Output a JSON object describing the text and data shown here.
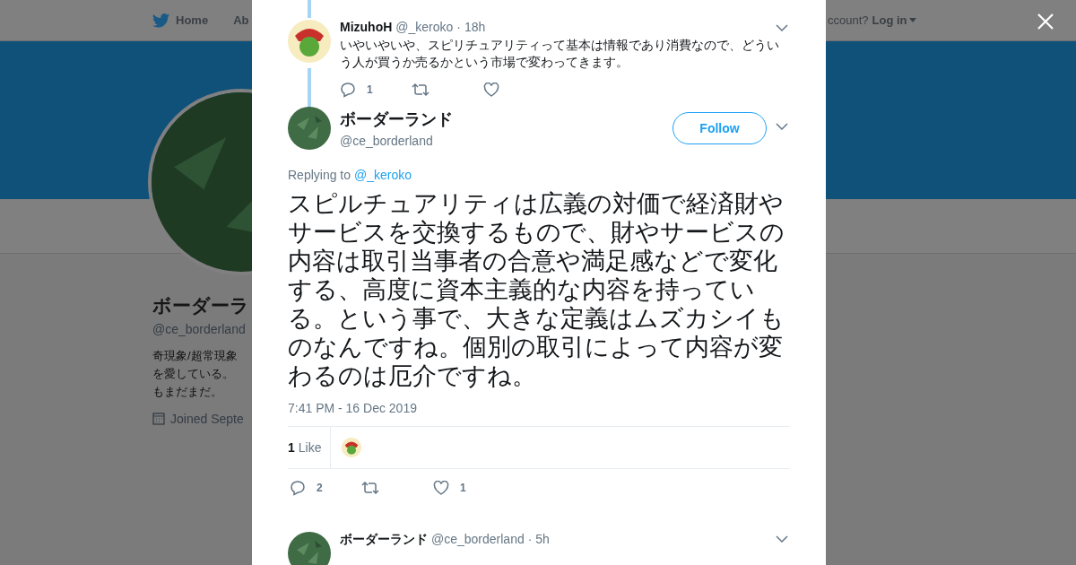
{
  "background_page": {
    "nav": {
      "home": "Home",
      "about": "Ab",
      "account_prompt": "ccount?",
      "login": "Log in"
    },
    "profile": {
      "name": "ボーダーラ",
      "handle": "@ce_borderland",
      "bio_lines": [
        "奇現象/超常現象",
        "を愛している。",
        "もまだまだ。"
      ],
      "joined": "Joined Septe"
    }
  },
  "modal": {
    "parent_tweet": {
      "name": "MizuhoH",
      "handle": "@_keroko",
      "time": "· 18h",
      "text": "いやいやいや、スピリチュアリティって基本は情報であり消費なので、どういう人が買うか売るかという市場で変わってきます。",
      "replies": "1"
    },
    "main_tweet": {
      "name": "ボーダーランド",
      "handle": "@ce_borderland",
      "follow": "Follow",
      "replying_label": "Replying to",
      "replying_to": "@_keroko",
      "text": "スピルチュアリティは広義の対価で経済財やサービスを交換するもので、財やサービスの内容は取引当事者の合意や満足感などで変化する、高度に資本主義的な内容を持っている。という事で、大きな定義はムズカシイものなんですね。個別の取引によって内容が変わるのは厄介ですね。",
      "timestamp": "7:41 PM - 16 Dec 2019",
      "like_count": "1",
      "like_label": "Like",
      "replies": "2",
      "likes": "1"
    },
    "next_tweet": {
      "name": "ボーダーランド",
      "handle": "@ce_borderland",
      "time": "· 5h"
    }
  }
}
